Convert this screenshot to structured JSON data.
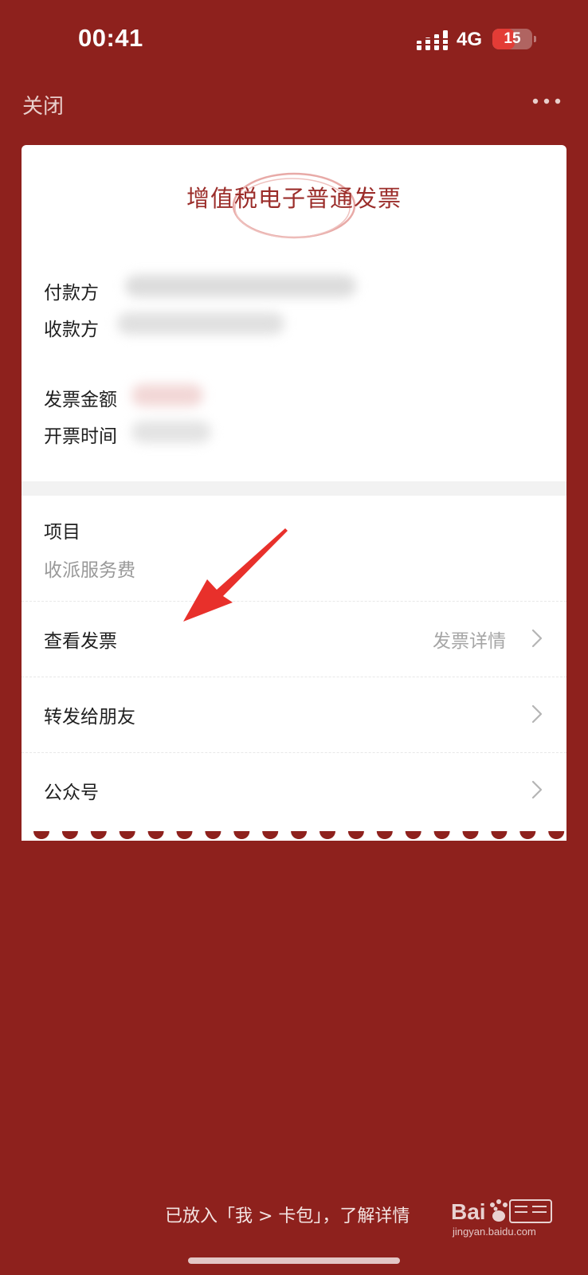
{
  "status_bar": {
    "time": "00:41",
    "network": "4G",
    "battery_level": "15",
    "battery_fraction": 0.15,
    "battery_color": "#e33c36"
  },
  "nav": {
    "close_label": "关闭",
    "more_icon": "more-dots-icon"
  },
  "invoice": {
    "title": "增值税电子普通发票",
    "payer_label": "付款方",
    "payee_label": "收款方",
    "amount_label": "发票金额",
    "issue_time_label": "开票时间"
  },
  "project": {
    "label": "项目",
    "value": "收派服务费"
  },
  "rows": [
    {
      "label": "查看发票",
      "hint": "发票详情"
    },
    {
      "label": "转发给朋友",
      "hint": ""
    },
    {
      "label": "公众号",
      "hint": ""
    }
  ],
  "footer": {
    "text": "已放入「我 > 卡包」，了解详情"
  },
  "watermark": {
    "url": "jingyan.baidu.com"
  },
  "colors": {
    "background": "#8e211d",
    "title": "#9b2d2a",
    "arrow": "#e8302b"
  }
}
